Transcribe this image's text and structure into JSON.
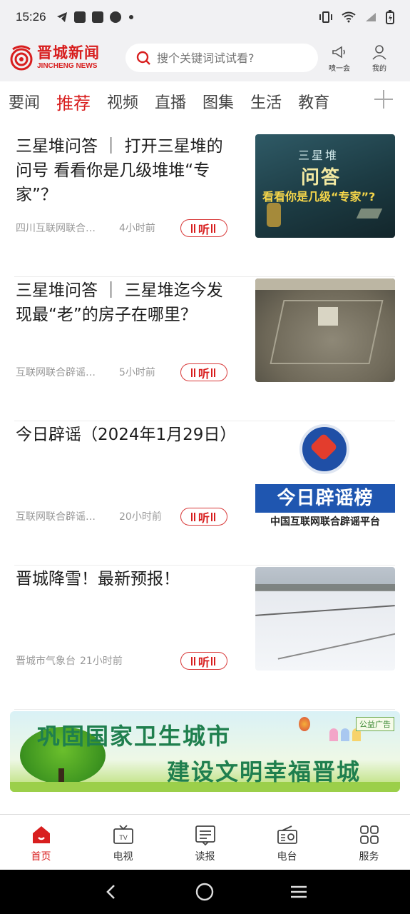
{
  "status_bar": {
    "time": "15:26"
  },
  "header": {
    "logo_cn": "晋城新闻",
    "logo_en": "JINCHENG NEWS",
    "search_placeholder": "搜个关键词试试看?",
    "shout_label": "喷一会",
    "mine_label": "我的"
  },
  "tabs": [
    {
      "label": "要闻",
      "active": false
    },
    {
      "label": "推荐",
      "active": true
    },
    {
      "label": "视频",
      "active": false
    },
    {
      "label": "直播",
      "active": false
    },
    {
      "label": "图集",
      "active": false
    },
    {
      "label": "生活",
      "active": false
    },
    {
      "label": "教育",
      "active": false
    }
  ],
  "news": [
    {
      "title": "三星堆问答 ｜ 打开三星堆的问号 看看你是几级堆堆“专家”？",
      "source": "四川互联网联合…",
      "time": "4小时前",
      "listen": "听",
      "thumb": {
        "line1": "三星堆",
        "line2": "问答",
        "line3": "看看你是几级“专家”?"
      }
    },
    {
      "title": "三星堆问答 ｜ 三星堆迄今发现最“老”的房子在哪里？",
      "source": "互联网联合辟谣…",
      "time": "5小时前",
      "listen": "听"
    },
    {
      "title": "今日辟谣（2024年1月29日）",
      "source": "互联网联合辟谣…",
      "time": "20小时前",
      "listen": "听",
      "thumb": {
        "band": "今日辟谣榜",
        "sub": "中国互联网联合辟谣平台"
      }
    },
    {
      "title": "晋城降雪！最新预报！",
      "source": "晋城市气象台",
      "time": "21小时前",
      "listen": "听"
    }
  ],
  "banner": {
    "line1": "巩固国家卫生城市",
    "line2": "建设文明幸福晋城",
    "tag": "公益广告"
  },
  "bottom_nav": [
    {
      "label": "首页",
      "icon": "home-icon",
      "active": true
    },
    {
      "label": "电视",
      "icon": "tv-icon",
      "active": false
    },
    {
      "label": "读报",
      "icon": "newspaper-icon",
      "active": false
    },
    {
      "label": "电台",
      "icon": "radio-icon",
      "active": false
    },
    {
      "label": "服务",
      "icon": "grid-icon",
      "active": false
    }
  ],
  "colors": {
    "accent": "#d81e1e",
    "bar_bg": "#f1f1f3"
  }
}
